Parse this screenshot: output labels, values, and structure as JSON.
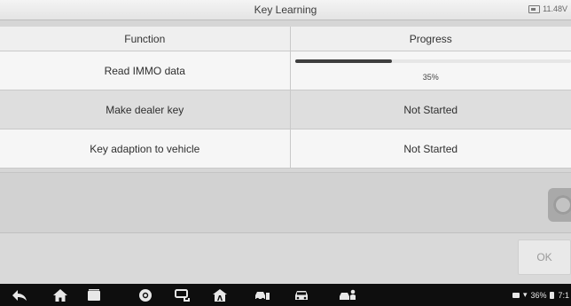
{
  "title_bar": {
    "title": "Key Learning",
    "battery_icon": "battery-icon",
    "voltage": "11.48V"
  },
  "table": {
    "columns": [
      "Function",
      "Progress"
    ],
    "rows": [
      {
        "function": "Read IMMO data",
        "progress_text": "35%",
        "progress_fraction": 0.35
      },
      {
        "function": "Make dealer key",
        "progress_text": "Not Started"
      },
      {
        "function": "Key adaption to vehicle",
        "progress_text": "Not Started"
      }
    ]
  },
  "buttons": {
    "ok_label": "OK",
    "floating_icon": "floating-menu-icon"
  },
  "nav_bar": {
    "icons": [
      "back-icon",
      "home-icon",
      "recent-apps-icon",
      "browser-icon",
      "vci-icon",
      "autel-home-icon",
      "vehicle-diagnostics-icon",
      "car-icon",
      "service-icon"
    ],
    "status": {
      "battery_percent": "36%",
      "time": "7:1"
    }
  },
  "colors": {
    "progress_fill": "#3e3e3e",
    "nav_bg": "#0e0e0e"
  }
}
